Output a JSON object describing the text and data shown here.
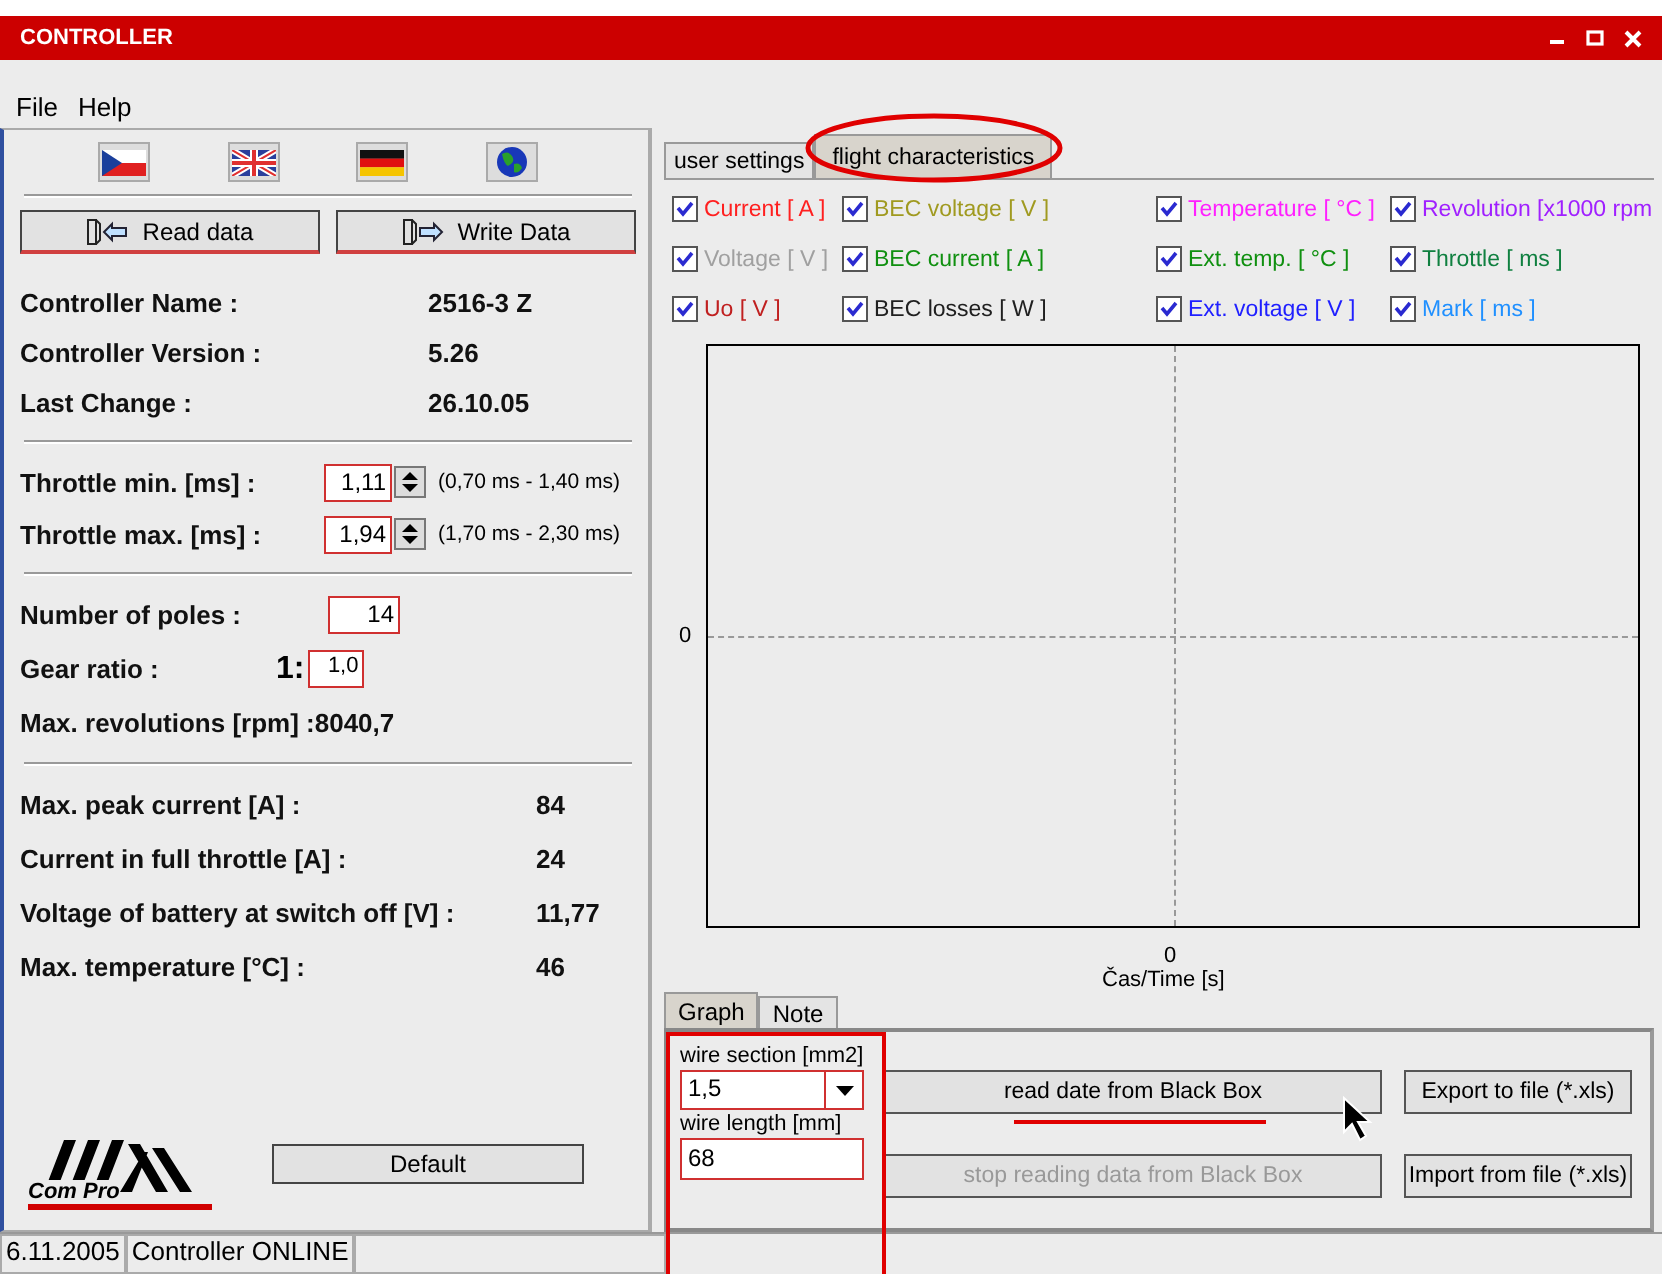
{
  "window": {
    "title": "CONTROLLER"
  },
  "menu": [
    "File",
    "Help"
  ],
  "language_buttons": [
    {
      "kind": "czech"
    },
    {
      "kind": "british"
    },
    {
      "kind": "german"
    },
    {
      "kind": "globe"
    }
  ],
  "data_buttons": [
    {
      "label": "Read data",
      "kind": "read"
    },
    {
      "label": "Write Data",
      "kind": "write"
    }
  ],
  "info": [
    {
      "label": "Controller Name :",
      "value": "2516-3 Z"
    },
    {
      "label": "Controller Version :",
      "value": "5.26"
    },
    {
      "label": "Last Change :",
      "value": "26.10.05"
    }
  ],
  "throttle": [
    {
      "label": "Throttle min. [ms] :",
      "value": "1,11",
      "range": "(0,70 ms - 1,40 ms)"
    },
    {
      "label": "Throttle max. [ms] :",
      "value": "1,94",
      "range": "(1,70 ms - 2,30 ms)"
    }
  ],
  "poles": {
    "label": "Number of poles :",
    "value": "14"
  },
  "gear": {
    "label": "Gear ratio :",
    "prefix": "1:",
    "value": "1,0"
  },
  "max_revolutions": {
    "label": "Max. revolutions [rpm] :",
    "value": "8040,7"
  },
  "stats": [
    {
      "label": "Max. peak current [A] :",
      "value": "84"
    },
    {
      "label": "Current in full throttle [A] :",
      "value": "24"
    },
    {
      "label": "Voltage of battery at switch off [V] :",
      "value": "11,77"
    },
    {
      "label": "Max. temperature [°C] :",
      "value": "46"
    }
  ],
  "logo": {
    "text": "Com Pro"
  },
  "default_button": "Default",
  "tabs": [
    {
      "label": "user settings",
      "selected": false
    },
    {
      "label": "flight characteristics",
      "selected": true
    }
  ],
  "series": [
    {
      "label": "Current [ A ]",
      "checked": true,
      "color": "#ff2020"
    },
    {
      "label": "BEC voltage [ V ]",
      "checked": true,
      "color": "#a09a20"
    },
    {
      "label": "Temperature [ °C ]",
      "checked": true,
      "color": "#ff20ff"
    },
    {
      "label": "Revolution [x1000 rpm",
      "checked": true,
      "color": "#a020ff"
    },
    {
      "label": "Voltage [ V ]",
      "checked": true,
      "color": "#a0a0a0"
    },
    {
      "label": "BEC current [ A ]",
      "checked": true,
      "color": "#109010"
    },
    {
      "label": "Ext. temp. [ °C ]",
      "checked": true,
      "color": "#109010"
    },
    {
      "label": "Throttle [ ms ]",
      "checked": true,
      "color": "#108040"
    },
    {
      "label": "Uo [ V ]",
      "checked": true,
      "color": "#c02020"
    },
    {
      "label": "BEC losses [ W ]",
      "checked": true,
      "color": "#202020"
    },
    {
      "label": "Ext. voltage [ V ]",
      "checked": true,
      "color": "#2020ff"
    },
    {
      "label": "Mark [ ms ]",
      "checked": true,
      "color": "#2090ff"
    }
  ],
  "chart": {
    "y_tick": "0",
    "x_tick": "0",
    "x_label": "Čas/Time [s]"
  },
  "bottom_tabs": [
    {
      "label": "Graph",
      "selected": true
    },
    {
      "label": "Note",
      "selected": false
    }
  ],
  "wire_section": {
    "label": "wire section [mm2]",
    "value": "1,5"
  },
  "wire_length": {
    "label": "wire length [mm]",
    "value": "68"
  },
  "actions": [
    {
      "label": "read date from Black Box",
      "disabled": false
    },
    {
      "label": "stop reading data from Black Box",
      "disabled": true
    }
  ],
  "file_buttons": [
    "Export to file (*.xls)",
    "Import from file (*.xls)"
  ],
  "status_bar": [
    "6.11.2005",
    "Controller ONLINE"
  ]
}
